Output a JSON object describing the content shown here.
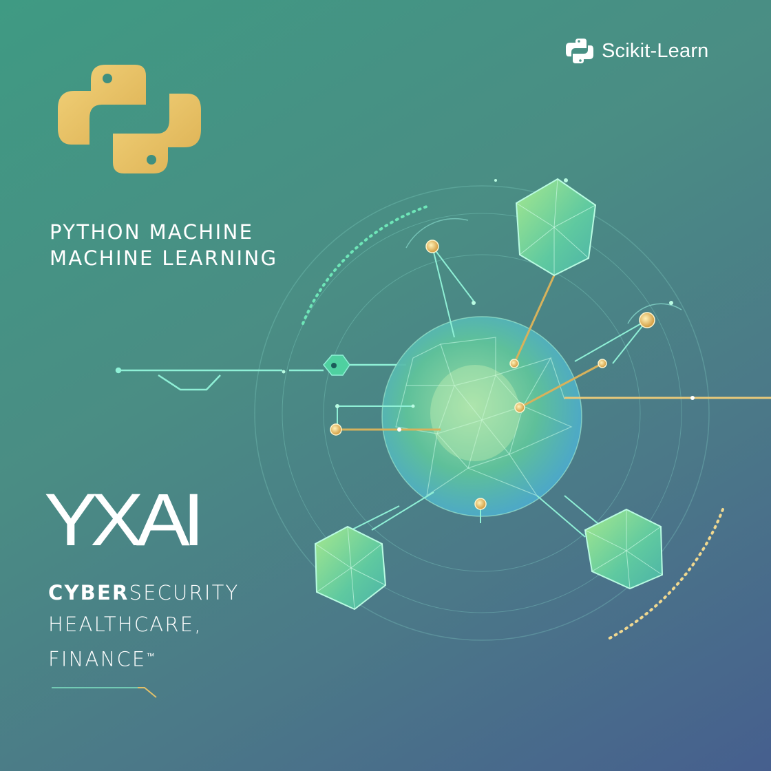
{
  "brand": {
    "label": "Scikit-Learn",
    "icon": "scikit-learn-icon"
  },
  "logo": {
    "icon": "python-logo-icon"
  },
  "headline": {
    "line1": "PYTHON MACHINE",
    "line2": "MACHINE LEARNING"
  },
  "xai": {
    "label": "YXAI"
  },
  "domains": {
    "items": [
      "CYBERSECURITY",
      "HEALTHCARE,",
      "FINANCE"
    ],
    "cyber_bold": "CYBER",
    "cyber_rest": "SECURITY",
    "finance_mark": "™"
  },
  "colors": {
    "background_start": "#3f9a83",
    "background_end": "#465f8e",
    "python_gold": "#e8c164",
    "accent_teal": "#5fe0c4",
    "accent_gold": "#d7b25c",
    "node_green": "#72d69a"
  }
}
